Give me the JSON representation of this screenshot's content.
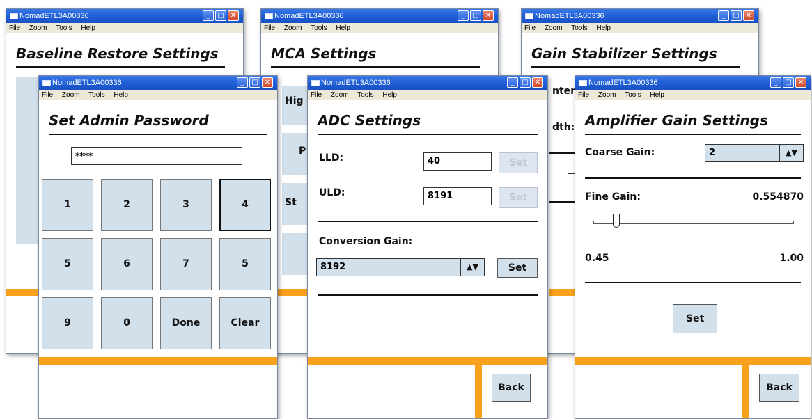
{
  "common": {
    "app_title": "NomadETL3A00336",
    "menu": [
      "File",
      "Zoom",
      "Tools",
      "Help"
    ],
    "window_buttons": {
      "minimize": "_",
      "maximize": "□",
      "close": "✕"
    }
  },
  "baseline_window": {
    "title": "Baseline Restore Settings"
  },
  "mca_window": {
    "title": "MCA Settings",
    "partial_labels": [
      "Hig",
      "P",
      "St"
    ]
  },
  "gain_stab_window": {
    "title": "Gain Stabilizer Settings",
    "partial_labels": [
      "nter:",
      "dth:"
    ]
  },
  "password_window": {
    "title": "Set Admin Password",
    "password_value": "****",
    "keys": [
      "1",
      "2",
      "3",
      "4",
      "5",
      "6",
      "7",
      "5",
      "9",
      "0",
      "Done",
      "Clear"
    ]
  },
  "adc_window": {
    "title": "ADC Settings",
    "lld_label": "LLD:",
    "lld_value": "40",
    "uld_label": "ULD:",
    "uld_value": "8191",
    "set_label": "Set",
    "conversion_gain_label": "Conversion Gain:",
    "conversion_gain_value": "8192",
    "back_label": "Back"
  },
  "amp_window": {
    "title": "Amplifier Gain Settings",
    "coarse_gain_label": "Coarse Gain:",
    "coarse_gain_value": "2",
    "fine_gain_label": "Fine Gain:",
    "fine_gain_value": "0.554870",
    "slider_min": "0.45",
    "slider_max": "1.00",
    "slider_fraction": 0.1,
    "set_label": "Set",
    "back_label": "Back"
  },
  "colors": {
    "accent_orange": "#f7a11c",
    "button_blue": "#d2e0ec",
    "titlebar_blue": "#1f5fd6"
  },
  "icons": {
    "spin_arrows": "▲▼",
    "window_icon": "window-icon"
  }
}
